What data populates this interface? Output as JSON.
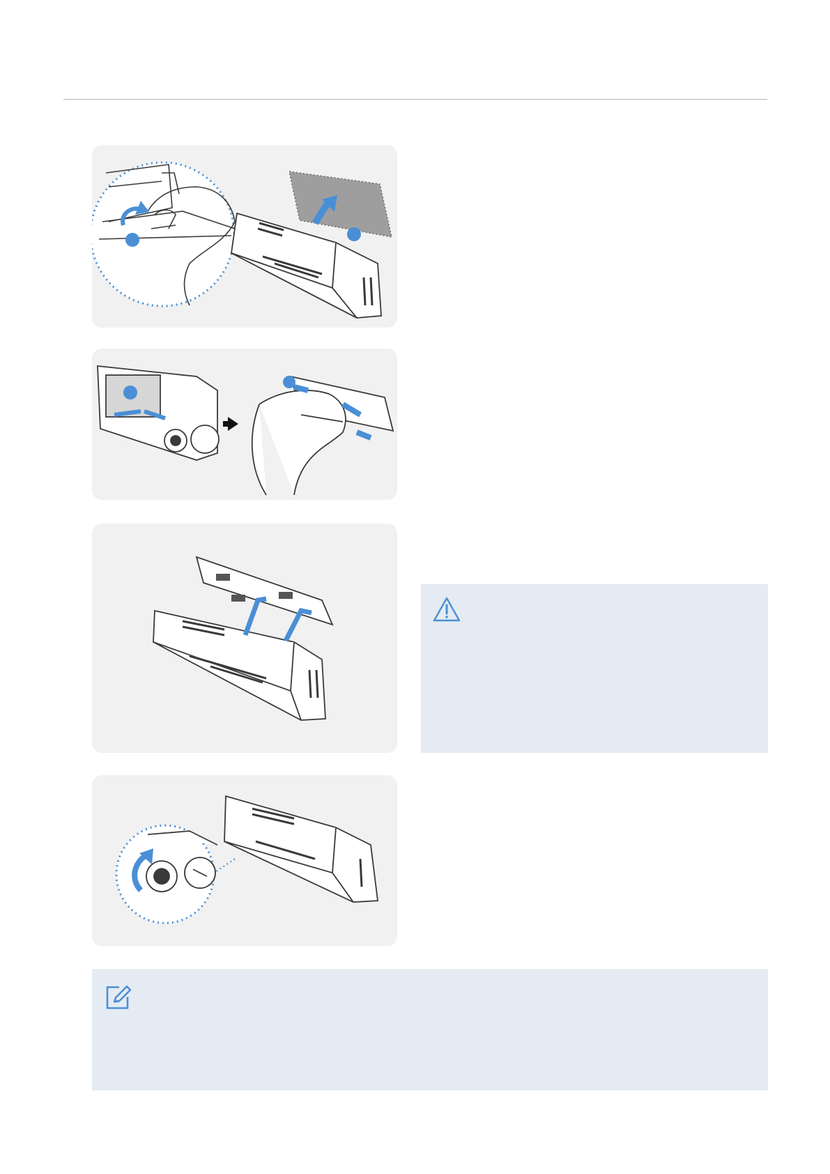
{
  "palette": {
    "accent_blue": "#4a8fd6",
    "panel_bg": "#f1f1f1",
    "callout_bg": "#e5ebf2",
    "rule": "#b3b3b3",
    "line_art": "#3a3a3a"
  },
  "steps": [
    {
      "illustration": "remove-adhesive-film-illustration",
      "markers": [
        "blue-step-marker",
        "blue-step-marker"
      ]
    },
    {
      "illustration": "attach-mount-to-camera-illustration",
      "markers": [
        "blue-step-marker",
        "blue-step-marker"
      ]
    },
    {
      "illustration": "slide-mount-onto-camera-illustration",
      "markers": []
    },
    {
      "illustration": "lens-cap-removal-illustration",
      "markers": []
    }
  ],
  "callouts": {
    "caution": {
      "icon": "caution-triangle-icon"
    },
    "note": {
      "icon": "note-pencil-icon"
    }
  }
}
